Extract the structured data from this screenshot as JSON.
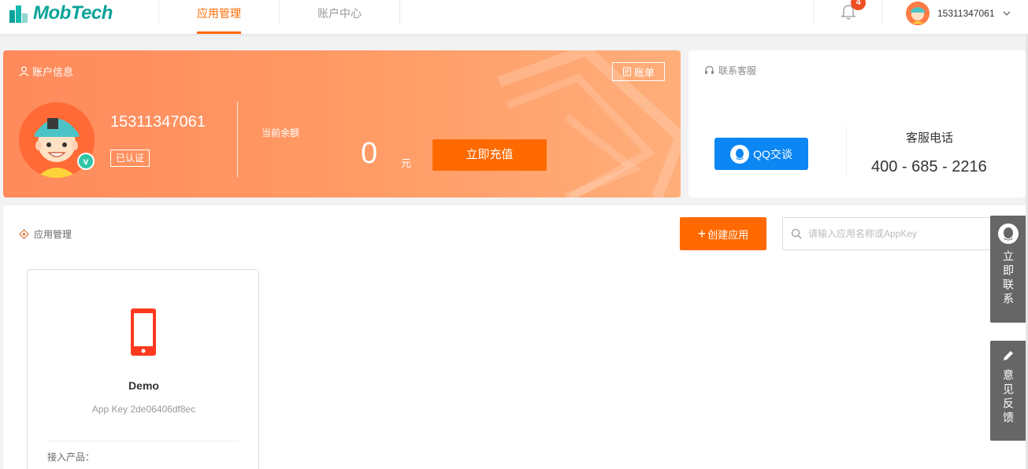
{
  "header": {
    "logo_text": "MobTech",
    "tabs": [
      {
        "label": "应用管理",
        "active": true
      },
      {
        "label": "账户中心",
        "active": false
      }
    ],
    "notification_count": "4",
    "user_name": "15311347061"
  },
  "account": {
    "title": "账户信息",
    "bill_label": "账单",
    "phone": "15311347061",
    "verified_label": "已认证",
    "verified_badge": "v",
    "balance_label": "当前余额",
    "balance_value": "0",
    "balance_unit": "元",
    "recharge_label": "立即充值"
  },
  "support": {
    "title": "联系客服",
    "qq_label": "QQ交谈",
    "hotline_label": "客服电话",
    "hotline_number": "400 - 685 - 2216"
  },
  "apps": {
    "title": "应用管理",
    "create_label": "创建应用",
    "search_placeholder": "请输入应用名称或AppKey",
    "items": [
      {
        "name": "Demo",
        "app_key": "App Key 2de06406df8ec",
        "product_label": "接入产品："
      }
    ]
  },
  "floating": {
    "contact_label": "立即联系",
    "feedback_label": "意见反馈"
  },
  "colors": {
    "accent": "#ff6a00",
    "brand": "#0aa39a",
    "qq_blue": "#0b86f3",
    "card_gradient_start": "#ff8a5c",
    "card_gradient_end": "#ffae7a"
  }
}
